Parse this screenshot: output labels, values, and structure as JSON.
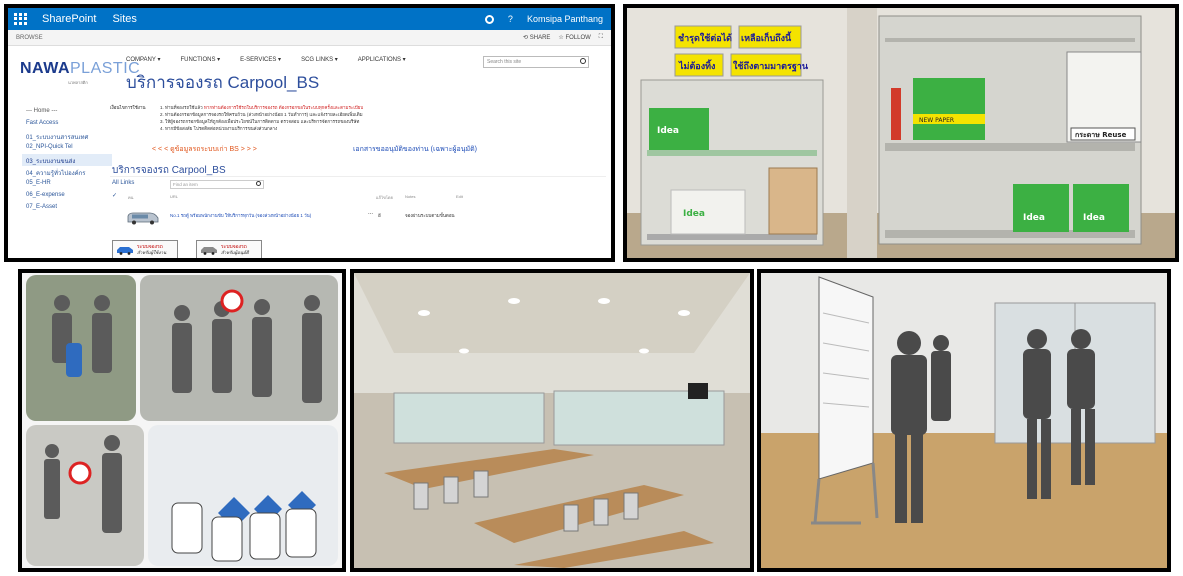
{
  "sharepoint": {
    "topbar": {
      "brand": "SharePoint",
      "sites": "Sites",
      "user": "Komsipa Panthang",
      "help": "?"
    },
    "ribbon": {
      "browse": "BROWSE",
      "share": "SHARE",
      "follow": "FOLLOW"
    },
    "logo": {
      "bold": "NAWA",
      "light": "PLASTIC",
      "sub": "นวพลาสติก"
    },
    "topnav": [
      "COMPANY ▾",
      "FUNCTIONS ▾",
      "E-SERVICES ▾",
      "SCG LINKS ▾",
      "APPLICATIONS ▾"
    ],
    "search_placeholder": "Search this site",
    "page_title": "บริการจองรถ Carpool_BS",
    "leftnav": [
      "--- Home ---",
      "Fast Access",
      "01_ระบบงานสารสนเทศ",
      "02_NPI-Quick Tel",
      "03_ระบบงานขนส่ง",
      "04_ความรู้ทั่วไปองค์กร",
      "05_E-HR",
      "06_E-expense",
      "07_E-Asset"
    ],
    "notice": {
      "label": "เงื่อนไขการใช้งาน",
      "line1_a": "1. ท่านที่จองรถใช้แล้ว ",
      "line1_b": "หากท่านต้องการใช้รถในบริการจองรถ ต้องกรอกขอในระบบทุกครั้งและตามระเบียบ",
      "line2": "2. ท่านต้องกรอกข้อมูลการจองรถให้ครบถ้วน (ล่วงหน้าอย่างน้อย 1 วันทำการ) และแจ้งรายละเอียดเพิ่มเติม",
      "line3": "3. ให้ผู้จองรถกรอกข้อมูลให้ถูกต้องเพื่อประโยชน์ในการติดตาม ตรวจสอบ และบริหารจัดการรถของบริษัท",
      "line4": "4. หากมีข้อสงสัย โปรดติดต่อหน่วยงานบริการขนส่งส่วนกลาง"
    },
    "link_left": "< < < ดูข้อมูลรถระบบเก่า BS > > >",
    "link_right": "เอกสารขออนุมัติของท่าน (เฉพาะผู้อนุมัติ)",
    "list_title": "บริการจองรถ Carpool_BS",
    "list": {
      "all_links": "All Links",
      "find_placeholder": "Find an item",
      "check": "✓",
      "headers": {
        "col1": "คน",
        "url": "URL",
        "modified": "แก้ไขโดย",
        "notes": "Notes",
        "edit": "Edit"
      },
      "row": {
        "url": "No.1 รถตู้ พร้อมพนักงานขับ ให้บริการทุกวัน (จองล่วงหน้าอย่างน้อย 1 วัน)",
        "dots": "...",
        "name": "อี",
        "notes": "จองผ่านระบบตามขั้นตอน"
      }
    },
    "buttons": [
      {
        "line1": "ระบบจองรถ",
        "line2": "สำหรับผู้ใช้งาน"
      },
      {
        "line1": "ระบบจองรถ",
        "line2": "สำหรับผู้อนุมัติ"
      }
    ]
  },
  "shelves_photo": {
    "signs": [
      "ชำรุดใช้ต่อได้",
      "เหลือเก็บถึงนี้",
      "ไม่ต้องทิ้ง",
      "ใช้ถึงตามมาตรฐาน"
    ],
    "box_labels": [
      "Idea",
      "Idea",
      "Idea",
      "Idea"
    ],
    "reuse_label": "กระดาษ Reuse",
    "new_paper": "NEW PAPER"
  },
  "colors": {
    "sp_blue": "#0072c6",
    "title_blue": "#2d4e9c",
    "notice_red": "#d02020",
    "link_orange": "#e0541a",
    "paper_green": "#3cb043",
    "sign_yellow": "#f4e300"
  }
}
